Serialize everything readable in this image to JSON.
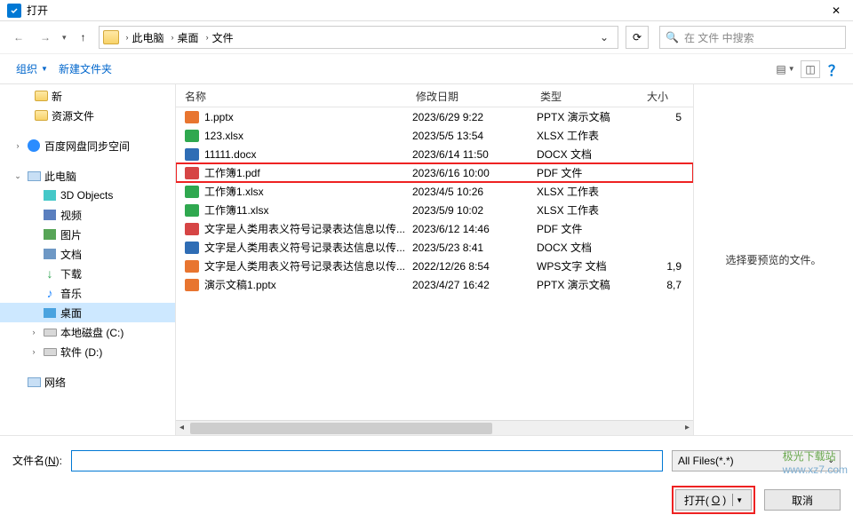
{
  "window": {
    "title": "打开"
  },
  "breadcrumb": {
    "root": "此电脑",
    "segs": [
      "桌面",
      "文件"
    ]
  },
  "search": {
    "placeholder": "在 文件 中搜索"
  },
  "toolbar": {
    "organize": "组织",
    "new_folder": "新建文件夹"
  },
  "tree": {
    "quick": [
      "新",
      "资源文件"
    ],
    "baidu": "百度网盘同步空间",
    "thispc": "此电脑",
    "pcitems": [
      "3D Objects",
      "视频",
      "图片",
      "文档",
      "下载",
      "音乐",
      "桌面",
      "本地磁盘 (C:)",
      "软件 (D:)"
    ],
    "network": "网络"
  },
  "columns": {
    "name": "名称",
    "date": "修改日期",
    "type": "类型",
    "size": "大小"
  },
  "files": [
    {
      "ico": "ico-pptx",
      "name": "1.pptx",
      "date": "2023/6/29 9:22",
      "type": "PPTX 演示文稿",
      "size": "5"
    },
    {
      "ico": "ico-xlsx",
      "name": "123.xlsx",
      "date": "2023/5/5 13:54",
      "type": "XLSX 工作表",
      "size": ""
    },
    {
      "ico": "ico-docx",
      "name": "11111.docx",
      "date": "2023/6/14 11:50",
      "type": "DOCX 文档",
      "size": ""
    },
    {
      "ico": "ico-pdf",
      "name": "工作簿1.pdf",
      "date": "2023/6/16 10:00",
      "type": "PDF 文件",
      "size": "",
      "hl": true
    },
    {
      "ico": "ico-xlsx",
      "name": "工作簿1.xlsx",
      "date": "2023/4/5 10:26",
      "type": "XLSX 工作表",
      "size": ""
    },
    {
      "ico": "ico-xlsx",
      "name": "工作簿11.xlsx",
      "date": "2023/5/9 10:02",
      "type": "XLSX 工作表",
      "size": ""
    },
    {
      "ico": "ico-pdf",
      "name": "文字是人类用表义符号记录表达信息以传...",
      "date": "2023/6/12 14:46",
      "type": "PDF 文件",
      "size": ""
    },
    {
      "ico": "ico-docx",
      "name": "文字是人类用表义符号记录表达信息以传...",
      "date": "2023/5/23 8:41",
      "type": "DOCX 文档",
      "size": ""
    },
    {
      "ico": "ico-wps",
      "name": "文字是人类用表义符号记录表达信息以传...",
      "date": "2022/12/26 8:54",
      "type": "WPS文字 文档",
      "size": "1,9"
    },
    {
      "ico": "ico-pptx",
      "name": "演示文稿1.pptx",
      "date": "2023/4/27 16:42",
      "type": "PPTX 演示文稿",
      "size": "8,7"
    }
  ],
  "preview": {
    "msg": "选择要预览的文件。"
  },
  "footer": {
    "fname_label_pre": "文件名(",
    "fname_label_ul": "N",
    "fname_label_post": "):",
    "filter": "All Files(*.*)",
    "open_pre": "打开(",
    "open_ul": "O",
    "open_post": ")",
    "cancel": "取消"
  },
  "watermark": {
    "cn": "极光下载站",
    "url": "www.xz7.com"
  }
}
